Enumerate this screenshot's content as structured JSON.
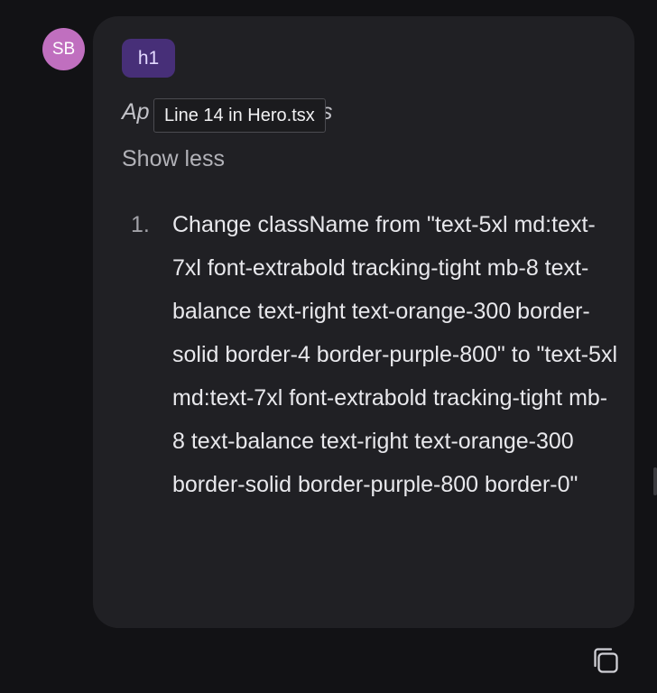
{
  "user": {
    "initials": "SB"
  },
  "message": {
    "element_tag": "h1",
    "applied_text_left": "Ap",
    "applied_text_right": "edits",
    "tooltip": "Line 14 in Hero.tsx",
    "toggle_label": "Show less",
    "edits": [
      {
        "number": "1.",
        "text": "Change className from \"text-5xl md:text-7xl font-extrabold tracking-tight mb-8 text-balance text-right text-orange-300 border-solid border-4 border-purple-800\" to \"text-5xl md:text-7xl font-extrabold tracking-tight mb-8 text-balance text-right text-orange-300 border-solid border-purple-800 border-0\""
      }
    ]
  },
  "actions": {
    "copy_icon": "copy-icon"
  },
  "colors": {
    "background": "#121215",
    "bubble": "#202024",
    "avatar": "#c06fbf",
    "tag": "#472f78"
  }
}
